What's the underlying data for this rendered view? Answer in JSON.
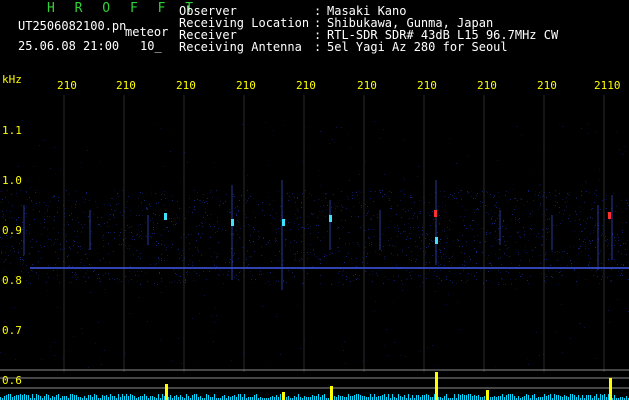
{
  "header": {
    "logo": "H R O F F T",
    "filename_left": "UT2506082100.pn",
    "filename_right": "meteor",
    "date": "25.06.08 21:00",
    "interval": "10_",
    "labels": [
      "Observer",
      "Receiving Location",
      "Receiver",
      "Receiving Antenna"
    ],
    "colons": [
      ":",
      ":",
      ":",
      ":"
    ],
    "values": [
      "Masaki Kano",
      "Shibukawa, Gunma, Japan",
      "RTL-SDR SDR# 43dB L15 96.7MHz CW",
      "5el Yagi Az 280 for Seoul"
    ]
  },
  "axis": {
    "unit": "kHz",
    "x_ticks": [
      "210",
      "210",
      "210",
      "210",
      "210",
      "210",
      "210",
      "210",
      "210",
      "2110"
    ],
    "y_ticks": [
      "1.1",
      "1.0",
      "0.9",
      "0.8",
      "0.7",
      "0.6"
    ]
  },
  "colors": {
    "background": "#000000",
    "noise": "#1a2ea8",
    "echo_cyan": "#40e0ff",
    "echo_red": "#ff3030",
    "baseline": "#3a4fd0",
    "level_bar": "#00d8ff",
    "peak": "#ffff00",
    "guide": "#b0b0b0",
    "grid": "#2a2a2a"
  }
}
